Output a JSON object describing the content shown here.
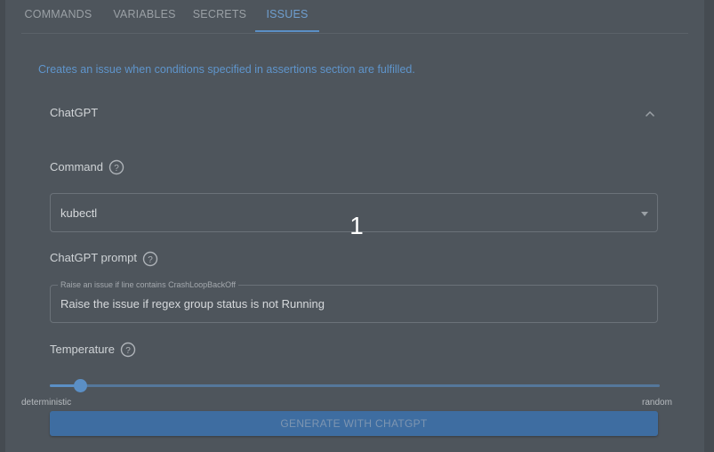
{
  "tabs": [
    {
      "label": "Commands",
      "active": false
    },
    {
      "label": "Variables",
      "active": false
    },
    {
      "label": "Secrets",
      "active": false
    },
    {
      "label": "Issues",
      "active": true
    }
  ],
  "description": "Creates an issue when conditions specified in assertions section are fulfilled.",
  "section": {
    "title": "ChatGPT",
    "collapse_icon": "chevron-up-icon"
  },
  "command": {
    "label": "Command",
    "help_icon": "help-circle-icon",
    "value": "kubectl",
    "dropdown_icon": "caret-down-icon"
  },
  "prompt": {
    "label": "ChatGPT prompt",
    "help_icon": "help-circle-icon",
    "placeholder": "Raise an issue if line contains CrashLoopBackOff",
    "value": "Raise the issue if regex group status is not Running"
  },
  "temperature": {
    "label": "Temperature",
    "help_icon": "help-circle-icon",
    "value_fraction": 0.05,
    "min_label": "deterministic",
    "max_label": "random"
  },
  "generate_button": {
    "label": "Generate with ChatGPT",
    "disabled": true
  },
  "step_badge": "1",
  "colors": {
    "accent": "#5b8fc5",
    "accent_text": "#6f9fd0",
    "button_bg": "#3e6da1"
  }
}
